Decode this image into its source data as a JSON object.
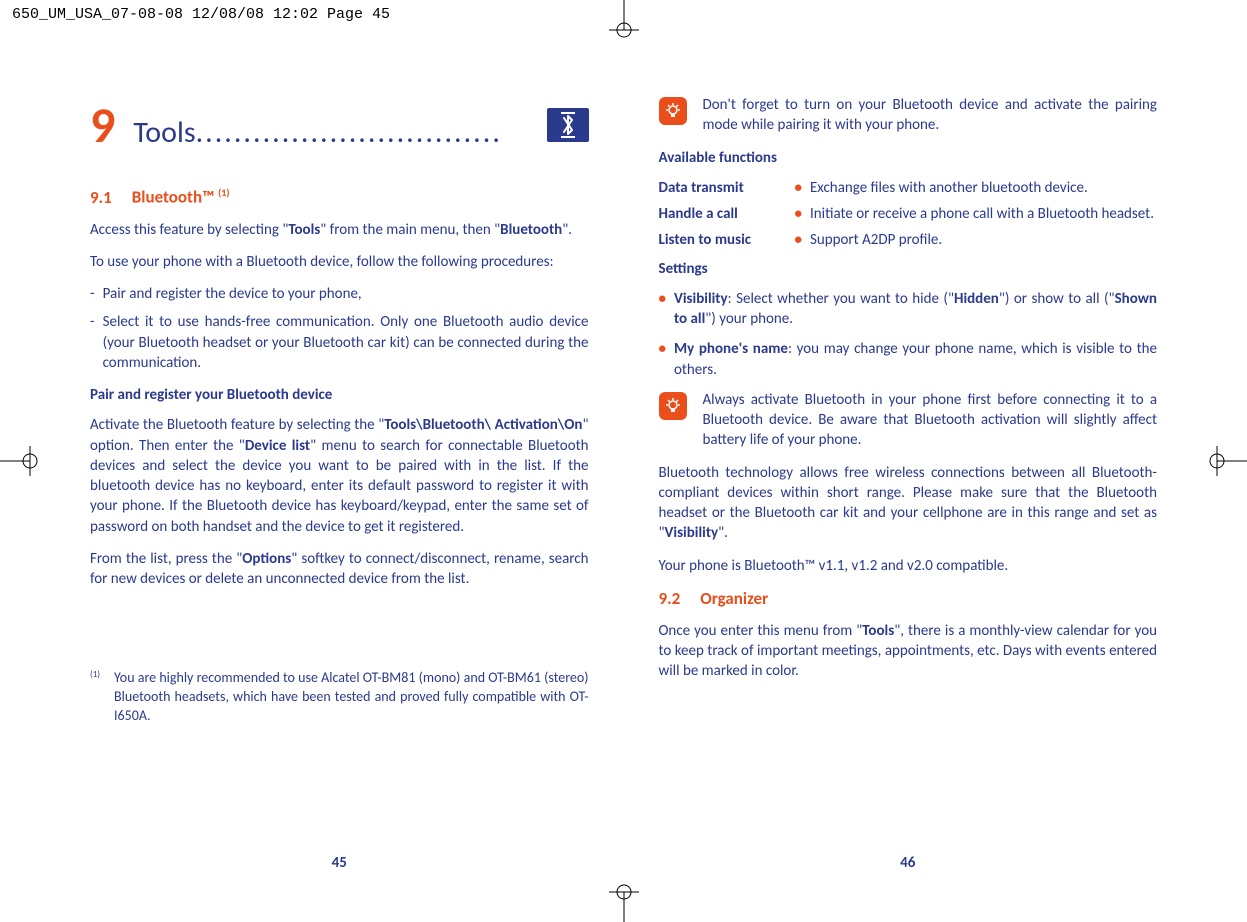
{
  "header": "650_UM_USA_07-08-08  12/08/08  12:02  Page 45",
  "chapter": {
    "number": "9",
    "title": "Tools",
    "dots": "................................"
  },
  "left": {
    "sect_num": "9.1",
    "sect_title": "Bluetooth™ ",
    "sect_sup": "(1)",
    "p1a": "Access this feature by selecting \"",
    "p1b": "Tools",
    "p1c": "\" from the main menu, then \"",
    "p1d": "Bluetooth",
    "p1e": "\".",
    "p2": "To use your phone with a Bluetooth device, follow the following procedures:",
    "b1": "Pair and register the device to your phone,",
    "b2": "Select it to use hands-free communication. Only one Bluetooth audio device (your Bluetooth headset or your Bluetooth car kit) can be connected during the communication.",
    "subhead": "Pair and register your Bluetooth device",
    "p3a": "Activate the Bluetooth feature by selecting the \"",
    "p3b": "Tools\\Bluetooth\\ Activation\\On",
    "p3c": "\" option.  Then enter the \"",
    "p3d": "Device list",
    "p3e": "\" menu to search for connectable Bluetooth devices and select the device you want to be paired with in the list. If the bluetooth device has no keyboard, enter its default password to register it with your phone. If the Bluetooth device has keyboard/keypad, enter the same set of password on both handset and the device to get it registered.",
    "p4a": "From the list, press the \"",
    "p4b": "Options",
    "p4c": "\" softkey to connect/disconnect, rename, search for new devices or delete an unconnected device from the list.",
    "fn_mark": "(1)",
    "footnote": "You are highly recommended to use Alcatel OT-BM81 (mono) and OT-BM61 (stereo) Bluetooth headsets, which have been tested and proved fully compatible with OT-I650A.",
    "page": "45"
  },
  "right": {
    "tip1": "Don't forget to turn on your Bluetooth device and activate the pairing mode while pairing it with your phone.",
    "avail": "Available functions",
    "f1_label": "Data transmit",
    "f1_desc": "Exchange files with another bluetooth device.",
    "f2_label": "Handle a call",
    "f2_desc": "Initiate or receive a phone call with a Bluetooth headset.",
    "f3_label": "Listen to music",
    "f3_desc": "Support A2DP profile.",
    "settings": "Settings",
    "s1a": "Visibility",
    "s1b": ": Select whether you want to hide (\"",
    "s1c": "Hidden",
    "s1d": "\") or show to all (\"",
    "s1e": "Shown to all",
    "s1f": "\") your phone.",
    "s2a": "My phone's name",
    "s2b": ": you may change your phone name, which is visible to the others.",
    "tip2": "Always activate Bluetooth in your phone first before connecting it to a Bluetooth device. Be aware that Bluetooth activation will slightly affect battery life of your phone.",
    "p1a": "Bluetooth technology allows free wireless connections between all Bluetooth-compliant devices within short range. Please make sure that the Bluetooth headset or the Bluetooth car kit and your cellphone are in this range and set as \"",
    "p1b": "Visibility",
    "p1c": "\".",
    "p2": "Your phone is Bluetooth™ v1.1, v1.2 and v2.0 compatible.",
    "sect_num": "9.2",
    "sect_title": "Organizer",
    "p3a": "Once you enter this menu from \"",
    "p3b": "Tools",
    "p3c": "\", there is a monthly-view calendar for you to keep track of important meetings, appointments, etc. Days with events entered will be marked in color.",
    "page": "46"
  }
}
